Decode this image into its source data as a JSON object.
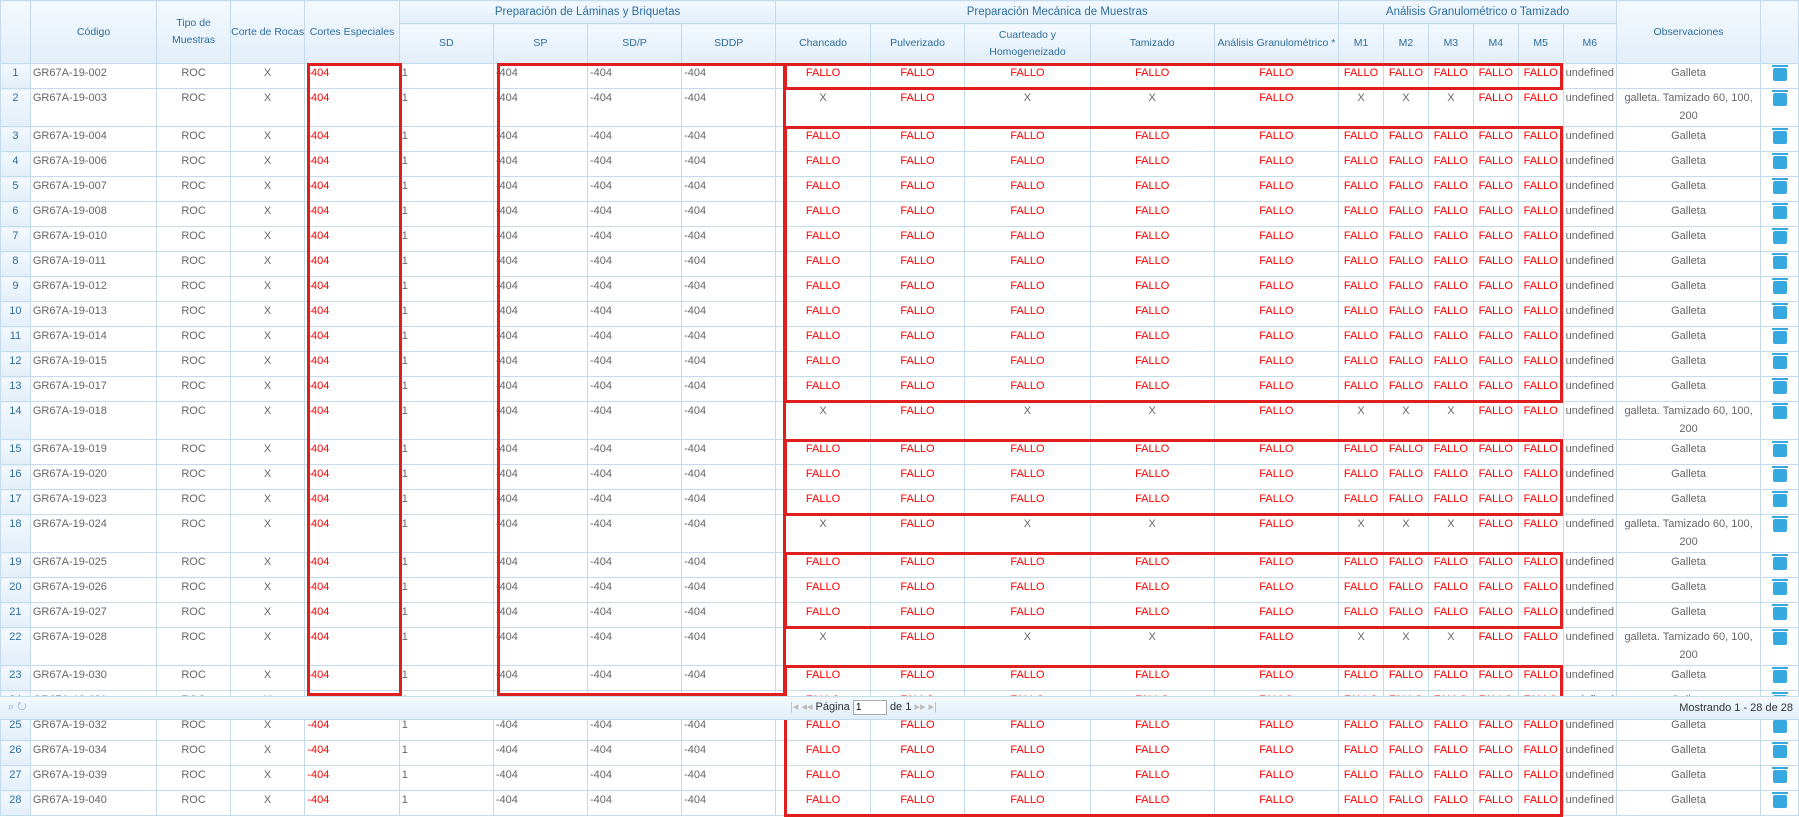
{
  "headers": {
    "codigo": "Código",
    "tipo": "Tipo de Muestras",
    "corte": "Corte de Rocas",
    "cortes_esp": "Cortes Especiales",
    "grp_laminas": "Preparación de Láminas y Briquetas",
    "grp_mecanica": "Preparación Mecánica de Muestras",
    "grp_granulo": "Análisis Granulométrico o Tamizado",
    "sd": "SD",
    "sp": "SP",
    "sdp": "SD/P",
    "sddp": "SDDP",
    "chancado": "Chancado",
    "pulverizado": "Pulverizado",
    "cuarteado": "Cuarteado y Homogeneizado",
    "tamizado": "Tamizado",
    "analisis": "Análisis Granulométrico *",
    "m1": "M1",
    "m2": "M2",
    "m3": "M3",
    "m4": "M4",
    "m5": "M5",
    "m6": "M6",
    "obs": "Observaciones"
  },
  "rows": [
    {
      "n": "1",
      "codigo": "GR67A-19-002",
      "mech": "F",
      "obs": "Galleta"
    },
    {
      "n": "2",
      "codigo": "GR67A-19-003",
      "mech": "X",
      "obs": "galleta. Tamizado 60, 100, 200"
    },
    {
      "n": "3",
      "codigo": "GR67A-19-004",
      "mech": "F",
      "obs": "Galleta"
    },
    {
      "n": "4",
      "codigo": "GR67A-19-006",
      "mech": "F",
      "obs": "Galleta"
    },
    {
      "n": "5",
      "codigo": "GR67A-19-007",
      "mech": "F",
      "obs": "Galleta"
    },
    {
      "n": "6",
      "codigo": "GR67A-19-008",
      "mech": "F",
      "obs": "Galleta"
    },
    {
      "n": "7",
      "codigo": "GR67A-19-010",
      "mech": "F",
      "obs": "Galleta"
    },
    {
      "n": "8",
      "codigo": "GR67A-19-011",
      "mech": "F",
      "obs": "Galleta"
    },
    {
      "n": "9",
      "codigo": "GR67A-19-012",
      "mech": "F",
      "obs": "Galleta"
    },
    {
      "n": "10",
      "codigo": "GR67A-19-013",
      "mech": "F",
      "obs": "Galleta"
    },
    {
      "n": "11",
      "codigo": "GR67A-19-014",
      "mech": "F",
      "obs": "Galleta"
    },
    {
      "n": "12",
      "codigo": "GR67A-19-015",
      "mech": "F",
      "obs": "Galleta"
    },
    {
      "n": "13",
      "codigo": "GR67A-19-017",
      "mech": "F",
      "obs": "Galleta"
    },
    {
      "n": "14",
      "codigo": "GR67A-19-018",
      "mech": "X",
      "obs": "galleta. Tamizado 60, 100, 200"
    },
    {
      "n": "15",
      "codigo": "GR67A-19-019",
      "mech": "F",
      "obs": "Galleta"
    },
    {
      "n": "16",
      "codigo": "GR67A-19-020",
      "mech": "F",
      "obs": "Galleta"
    },
    {
      "n": "17",
      "codigo": "GR67A-19-023",
      "mech": "F",
      "obs": "Galleta"
    },
    {
      "n": "18",
      "codigo": "GR67A-19-024",
      "mech": "X",
      "obs": "galleta. Tamizado 60, 100, 200"
    },
    {
      "n": "19",
      "codigo": "GR67A-19-025",
      "mech": "F",
      "obs": "Galleta"
    },
    {
      "n": "20",
      "codigo": "GR67A-19-026",
      "mech": "F",
      "obs": "Galleta"
    },
    {
      "n": "21",
      "codigo": "GR67A-19-027",
      "mech": "F",
      "obs": "Galleta"
    },
    {
      "n": "22",
      "codigo": "GR67A-19-028",
      "mech": "X",
      "obs": "galleta. Tamizado 60, 100, 200"
    },
    {
      "n": "23",
      "codigo": "GR67A-19-030",
      "mech": "F",
      "obs": "Galleta"
    },
    {
      "n": "24",
      "codigo": "GR67A-19-031",
      "mech": "F",
      "obs": "Galleta"
    },
    {
      "n": "25",
      "codigo": "GR67A-19-032",
      "mech": "F",
      "obs": "Galleta"
    },
    {
      "n": "26",
      "codigo": "GR67A-19-034",
      "mech": "F",
      "obs": "Galleta"
    },
    {
      "n": "27",
      "codigo": "GR67A-19-039",
      "mech": "F",
      "obs": "Galleta"
    },
    {
      "n": "28",
      "codigo": "GR67A-19-040",
      "mech": "F",
      "obs": "Galleta"
    }
  ],
  "values": {
    "tipo": "ROC",
    "corte": "X",
    "err": "-404",
    "sd": "1",
    "fallo": "FALLO",
    "x": "X",
    "undef": "undefined"
  },
  "pager": {
    "page_label": "Página",
    "page_value": "1",
    "of_label": "de 1",
    "summary": "Mostrando 1 - 28 de 28"
  },
  "colors": {
    "highlight": "#e01e1e",
    "error": "#ff0000",
    "header_text": "#2e6e9e"
  }
}
